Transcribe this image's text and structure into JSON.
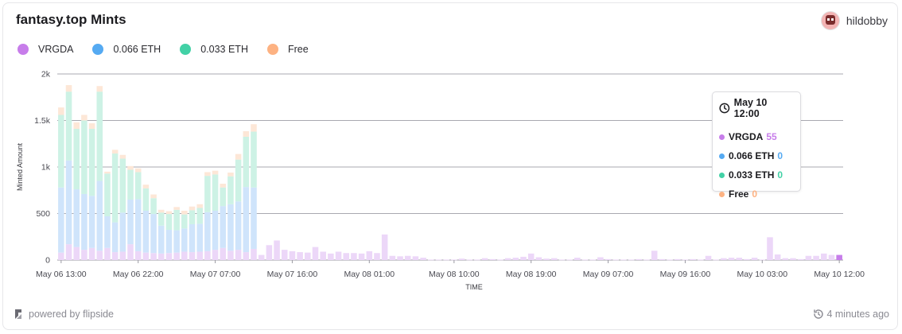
{
  "header": {
    "title": "fantasy.top Mints",
    "username": "hildobby"
  },
  "footer": {
    "powered_by": "powered by flipside",
    "updated": "4 minutes ago"
  },
  "tooltip": {
    "time": "May 10 12:00",
    "rows": [
      {
        "label": "VRGDA",
        "value": "55",
        "color": "#c77dea"
      },
      {
        "label": "0.066 ETH",
        "value": "0",
        "color": "#55aaf2"
      },
      {
        "label": "0.033 ETH",
        "value": "0",
        "color": "#42d1a6"
      },
      {
        "label": "Free",
        "value": "0",
        "color": "#fdb282"
      }
    ]
  },
  "chart_data": {
    "type": "bar",
    "stacked": true,
    "xlabel": "TIME",
    "ylabel": "Minted Amount",
    "ylim": [
      0,
      2000
    ],
    "yticks": [
      "0",
      "500",
      "1k",
      "1.5k",
      "2k"
    ],
    "xticks": [
      "May 06 13:00",
      "May 06 22:00",
      "May 07 07:00",
      "May 07 16:00",
      "May 08 01:00",
      "May 08 10:00",
      "May 08 19:00",
      "May 09 07:00",
      "May 09 16:00",
      "May 10 03:00",
      "May 10 12:00"
    ],
    "grid": true,
    "legend": "top-left",
    "series": [
      {
        "name": "VRGDA",
        "color": "#c77dea",
        "values": [
          80,
          170,
          140,
          110,
          130,
          100,
          130,
          85,
          90,
          170,
          95,
          80,
          75,
          70,
          75,
          80,
          90,
          85,
          90,
          95,
          110,
          130,
          100,
          110,
          85,
          120,
          55,
          160,
          210,
          110,
          95,
          85,
          80,
          140,
          90,
          70,
          90,
          75,
          75,
          70,
          95,
          75,
          275,
          45,
          40,
          45,
          40,
          25,
          5,
          5,
          5,
          5,
          15,
          5,
          5,
          20,
          10,
          5,
          20,
          25,
          35,
          70,
          30,
          15,
          20,
          5,
          5,
          25,
          5,
          5,
          30,
          10,
          5,
          5,
          5,
          10,
          5,
          100,
          10,
          5,
          10,
          5,
          10,
          5,
          45,
          5,
          20,
          25,
          25,
          10,
          25,
          5,
          245,
          60,
          20,
          20,
          10,
          45,
          45,
          70,
          55,
          55
        ]
      },
      {
        "name": "0.066 ETH",
        "color": "#55aaf2",
        "values": [
          700,
          900,
          620,
          600,
          560,
          750,
          340,
          320,
          420,
          480,
          560,
          450,
          420,
          300,
          250,
          240,
          250,
          300,
          300,
          420,
          420,
          450,
          500,
          520,
          700,
          660,
          0,
          0,
          0,
          0,
          0,
          0,
          0,
          0,
          0,
          0,
          0,
          0,
          0,
          0,
          0,
          0,
          0,
          0,
          0,
          0,
          0,
          0,
          0,
          0,
          0,
          0,
          0,
          0,
          0,
          0,
          0,
          0,
          0,
          0,
          0,
          0,
          0,
          0,
          0,
          0,
          0,
          0,
          0,
          0,
          0,
          0,
          0,
          0,
          0,
          0,
          0,
          0,
          0,
          0,
          0,
          0,
          0,
          0,
          0,
          0,
          0,
          0,
          0,
          0,
          0,
          0,
          0,
          0,
          0,
          0,
          0,
          0,
          0,
          0,
          0,
          0
        ]
      },
      {
        "name": "0.033 ETH",
        "color": "#42d1a6",
        "values": [
          780,
          740,
          650,
          790,
          720,
          960,
          460,
          740,
          580,
          320,
          290,
          240,
          170,
          140,
          170,
          220,
          150,
          150,
          170,
          390,
          390,
          200,
          300,
          450,
          540,
          600,
          0,
          0,
          0,
          0,
          0,
          0,
          0,
          0,
          0,
          0,
          0,
          0,
          0,
          0,
          0,
          0,
          0,
          0,
          0,
          0,
          0,
          0,
          0,
          0,
          0,
          0,
          0,
          0,
          0,
          0,
          0,
          0,
          0,
          0,
          0,
          0,
          0,
          0,
          0,
          0,
          0,
          0,
          0,
          0,
          0,
          0,
          0,
          0,
          0,
          0,
          0,
          0,
          0,
          0,
          0,
          0,
          0,
          0,
          0,
          0,
          0,
          0,
          0,
          0,
          0,
          0,
          0,
          0,
          0,
          0,
          0,
          0,
          0,
          0,
          0,
          0
        ]
      },
      {
        "name": "Free",
        "color": "#fdb282",
        "values": [
          80,
          70,
          70,
          60,
          60,
          60,
          20,
          40,
          40,
          40,
          40,
          40,
          40,
          30,
          30,
          30,
          40,
          40,
          40,
          40,
          40,
          40,
          40,
          60,
          60,
          80,
          0,
          0,
          0,
          0,
          0,
          0,
          0,
          0,
          0,
          0,
          0,
          0,
          0,
          0,
          0,
          0,
          0,
          0,
          0,
          0,
          0,
          0,
          0,
          0,
          0,
          0,
          0,
          0,
          0,
          0,
          0,
          0,
          0,
          0,
          0,
          0,
          0,
          0,
          0,
          0,
          0,
          0,
          0,
          0,
          0,
          0,
          0,
          0,
          0,
          0,
          0,
          0,
          0,
          0,
          0,
          0,
          0,
          0,
          0,
          0,
          0,
          0,
          0,
          0,
          0,
          0,
          0,
          0,
          0,
          0,
          0,
          0,
          0,
          0,
          0,
          0
        ]
      }
    ]
  }
}
